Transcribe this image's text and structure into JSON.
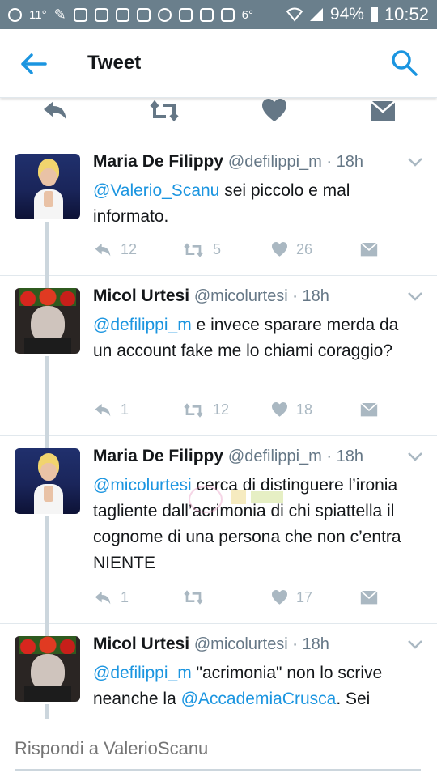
{
  "status_bar": {
    "left_text": "11°",
    "temp": "6°",
    "battery": "94%",
    "time": "10:52"
  },
  "header": {
    "title": "Tweet",
    "icons": [
      "back-arrow-icon",
      "search-icon"
    ]
  },
  "colors": {
    "accent": "#1b95e0",
    "status_bar": "#6a7f8c",
    "muted": "#aab8c2",
    "text_secondary": "#657786"
  },
  "tweets": [
    {
      "name": "Maria De Filippy",
      "handle": "@defilippi_m · 18h",
      "mention": "@Valerio_Scanu",
      "text": " sei piccolo e mal informato.",
      "replies": "12",
      "retweets": "5",
      "likes": "26"
    },
    {
      "name": "Micol Urtesi",
      "handle": "@micolurtesi · 18h",
      "mention": "@defilippi_m",
      "text": " e invece sparare merda da un account fake me lo chiami coraggio?",
      "replies": "1",
      "retweets": "12",
      "likes": "18"
    },
    {
      "name": "Maria De Filippy",
      "handle": "@defilippi_m · 18h",
      "mention": "@micolurtesi",
      "text": " cerca di distinguere l’ironia tagliente dall’acrimonia di chi spiattella il cognome di una persona che non c’entra NIENTE",
      "replies": "1",
      "retweets": "",
      "likes": "17"
    },
    {
      "name": "Micol Urtesi",
      "handle": "@micolurtesi · 18h",
      "mention": "@defilippi_m",
      "text": " \"acrimonia\" non lo scrive neanche la ",
      "mention2": "@AccademiaCrusca",
      "text2": ". Sei"
    }
  ],
  "reply": {
    "placeholder": "Rispondi a ValerioScanu"
  }
}
